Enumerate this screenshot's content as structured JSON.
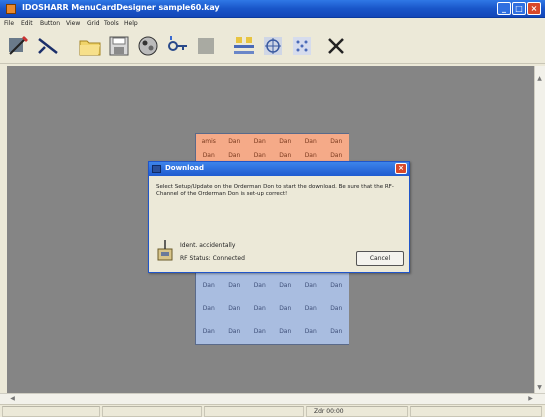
{
  "window": {
    "title": "IDOSHARR MenuCardDesigner sample60.kay"
  },
  "menubar": {
    "items": [
      {
        "label": "File"
      },
      {
        "label": "Edit"
      },
      {
        "label": "Button"
      },
      {
        "label": "View"
      },
      {
        "label": "Grid"
      },
      {
        "label": "Tools"
      },
      {
        "label": "Help"
      }
    ]
  },
  "toolbar": {
    "tools": [
      {
        "icon": "pen-tool-icon"
      },
      {
        "icon": "arrow-tool-icon"
      },
      {
        "icon": "folder-open-icon"
      },
      {
        "icon": "save-icon"
      },
      {
        "icon": "paint-icon"
      },
      {
        "icon": "key-tool-icon"
      },
      {
        "icon": "block-icon"
      },
      {
        "icon": "transfer-icon"
      },
      {
        "icon": "compass-icon"
      },
      {
        "icon": "dotted-grid-icon"
      },
      {
        "icon": "cross-icon"
      }
    ]
  },
  "grid": {
    "salmon_rows": [
      [
        "amis",
        "Dan",
        "Dan",
        "Dan",
        "Dan",
        "Dan"
      ],
      [
        "Dan",
        "Dan",
        "Dan",
        "Dan",
        "Dan",
        "Dan"
      ]
    ],
    "blue_rows": [
      [
        "Dan",
        "Dan",
        "Dan",
        "Dan",
        "Dan",
        "Dan"
      ],
      [
        "Dan",
        "Dan",
        "Dan",
        "Dan",
        "Dan",
        "Dan"
      ],
      [
        "Dan",
        "Dan",
        "Dan",
        "Dan",
        "Dan",
        "Dan"
      ]
    ],
    "colors": {
      "salmon": "#f5aa88",
      "blue": "#a9bde0"
    }
  },
  "dialog": {
    "title": "Download",
    "message": "Select Setup/Update on the Orderman Don to start the download. Be sure that the RF-Channel of the Orderman Don is set-up correct!",
    "line1": "Ident. accidentally",
    "line2": "RF Status: Connected",
    "cancel_label": "Cancel"
  },
  "statusbar": {
    "text": "Zdr 00:00"
  },
  "colors": {
    "titlebar": "#1956c9",
    "workspace": "#858585",
    "dialog_close": "#d8482a"
  }
}
